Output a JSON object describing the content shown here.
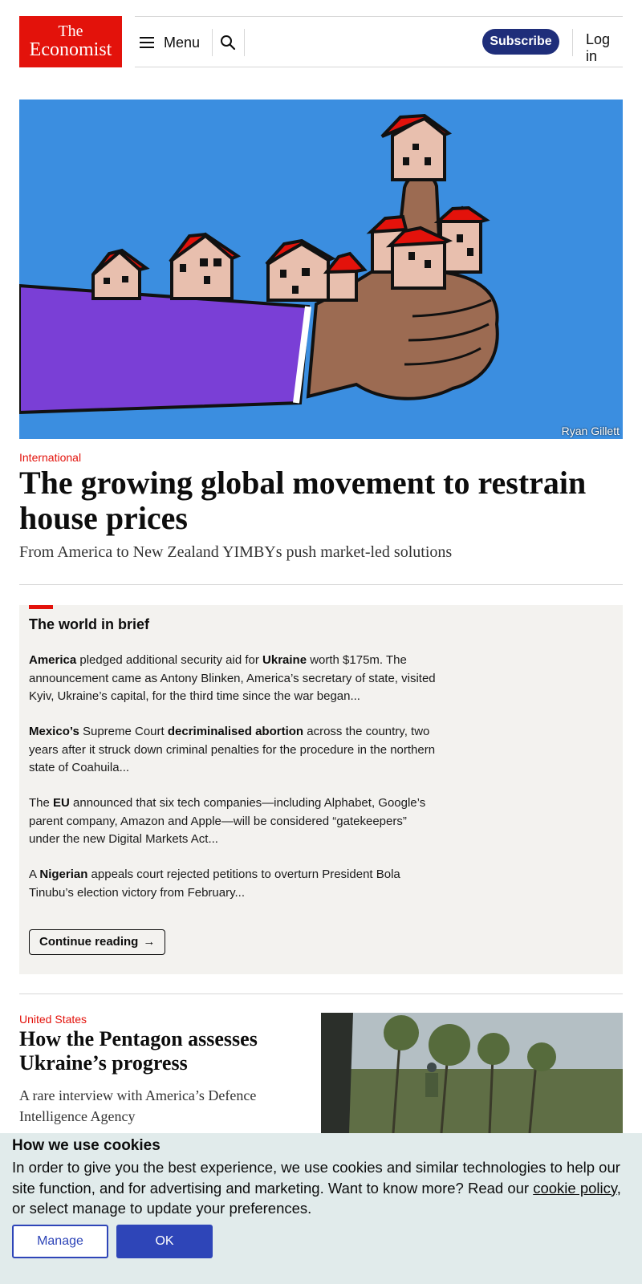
{
  "header": {
    "logo_line1": "The",
    "logo_line2": "Economist",
    "menu_label": "Menu",
    "search_icon": "search-icon",
    "subscribe_label": "Subscribe",
    "login_label": "Log in"
  },
  "hero": {
    "image_credit": "Ryan Gillett",
    "section": "International",
    "title": "The growing global movement to restrain house prices",
    "subtitle": "From America to New Zealand YIMBYs push market-led solutions"
  },
  "brief": {
    "title": "The world in brief",
    "items": [
      {
        "parts": [
          {
            "b": true,
            "t": "America"
          },
          {
            "b": false,
            "t": " pledged additional security aid for "
          },
          {
            "b": true,
            "t": "Ukraine"
          },
          {
            "b": false,
            "t": " worth $175m. The announcement came as Antony Blinken, America’s secretary of state, visited Kyiv, Ukraine’s capital, for the third time since the war began..."
          }
        ]
      },
      {
        "parts": [
          {
            "b": true,
            "t": "Mexico’s"
          },
          {
            "b": false,
            "t": " Supreme Court "
          },
          {
            "b": true,
            "t": "decriminalised abortion"
          },
          {
            "b": false,
            "t": " across the country, two years after it struck down criminal penalties for the procedure in the northern state of Coahuila..."
          }
        ]
      },
      {
        "parts": [
          {
            "b": false,
            "t": "The "
          },
          {
            "b": true,
            "t": "EU"
          },
          {
            "b": false,
            "t": " announced that six tech companies—including Alphabet, Google’s parent company, Amazon and Apple—will be considered “gatekeepers” under the new Digital Markets Act..."
          }
        ]
      },
      {
        "parts": [
          {
            "b": false,
            "t": "A "
          },
          {
            "b": true,
            "t": "Nigerian"
          },
          {
            "b": false,
            "t": " appeals court rejected petitions to overturn President Bola Tinubu’s election victory from February..."
          }
        ]
      }
    ],
    "continue_label": "Continue reading",
    "continue_arrow": "→"
  },
  "article2": {
    "section": "United States",
    "title": "How the Pentagon assesses Ukraine’s progress",
    "subtitle": "A rare interview with America’s Defence Intelligence Agency"
  },
  "cookie": {
    "title": "How we use cookies",
    "text_before": "In order to give you the best experience, we use cookies and similar technologies to help our site function, and for advertising and marketing. Want to know more? Read our ",
    "link_text": "cookie policy",
    "text_after": ", or select manage to update your preferences.",
    "manage_label": "Manage",
    "ok_label": "OK"
  },
  "colors": {
    "brand_red": "#e3120b",
    "subscribe_blue": "#1f2e7a",
    "cookie_button_blue": "#2e45b8",
    "hero_sky": "#3b8ee0",
    "sleeve_purple": "#7a3fd6"
  }
}
